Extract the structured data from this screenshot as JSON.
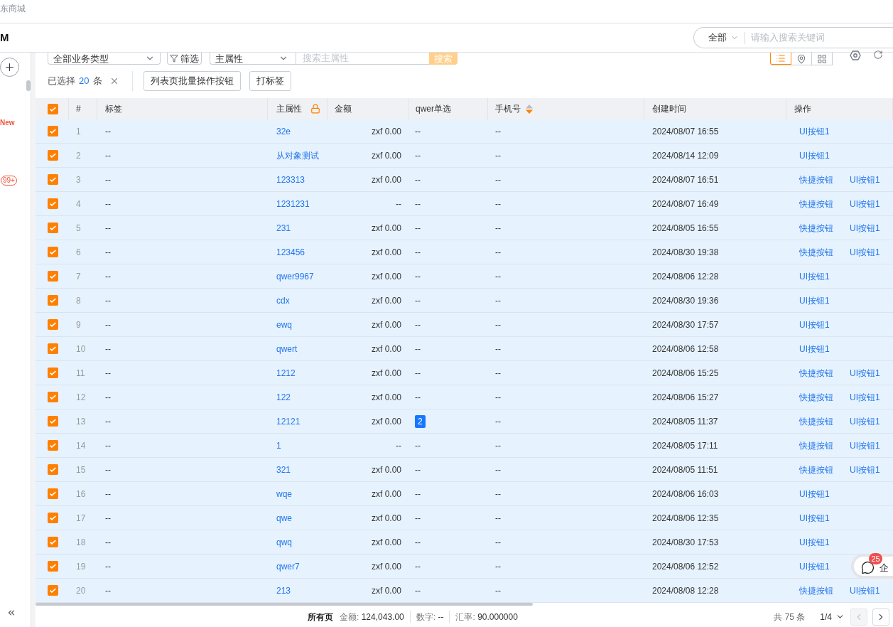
{
  "top_bar": {
    "title": "东商城"
  },
  "header": {
    "logo": "M",
    "search": {
      "scope": "全部",
      "placeholder": "请输入搜索关键词"
    }
  },
  "sidebar": {
    "badges": [
      {
        "kind": "text",
        "text": "New"
      },
      {
        "kind": "pill",
        "text": "99+"
      }
    ]
  },
  "toolbar": {
    "business_type": "全部业务类型",
    "filter": "筛选",
    "field": "主属性",
    "search_placeholder": "搜索主属性",
    "search_button": "搜索",
    "views": [
      {
        "kind": "list",
        "selected": true
      },
      {
        "kind": "map",
        "selected": false
      },
      {
        "kind": "grid",
        "selected": false
      }
    ]
  },
  "selection": {
    "label": "已选择",
    "count": "20",
    "unit": "条",
    "buttons": [
      "列表页批量操作按钮",
      "打标签"
    ]
  },
  "table": {
    "select_all": true,
    "columns": [
      {
        "label": "#",
        "kind": "plain"
      },
      {
        "label": "标签",
        "kind": "plain"
      },
      {
        "label": "主属性",
        "kind": "locked"
      },
      {
        "label": "金额",
        "kind": "plain"
      },
      {
        "label": "qwer单选",
        "kind": "plain"
      },
      {
        "label": "手机号",
        "kind": "sortable",
        "sort_descending": true
      },
      {
        "label": "创建时间",
        "kind": "plain"
      },
      {
        "label": "操作",
        "kind": "plain"
      }
    ],
    "rows": [
      {
        "selected": true,
        "index": "1",
        "tag": "--",
        "name": "32e",
        "amount": "zxf 0.00",
        "radio": {
          "kind": "plain",
          "text": "--"
        },
        "phone": "--",
        "created": "2024/08/07 16:55",
        "actions": [
          "UI按钮1"
        ]
      },
      {
        "selected": true,
        "index": "2",
        "tag": "--",
        "name": "从对象测试",
        "amount": "zxf 0.00",
        "radio": {
          "kind": "plain",
          "text": "--"
        },
        "phone": "--",
        "created": "2024/08/14 12:09",
        "actions": [
          "UI按钮1"
        ]
      },
      {
        "selected": true,
        "index": "3",
        "tag": "--",
        "name": "123313",
        "amount": "zxf 0.00",
        "radio": {
          "kind": "plain",
          "text": "--"
        },
        "phone": "--",
        "created": "2024/08/07 16:51",
        "actions": [
          "快捷按钮",
          "UI按钮1"
        ]
      },
      {
        "selected": true,
        "index": "4",
        "tag": "--",
        "name": "1231231",
        "amount": "--",
        "radio": {
          "kind": "plain",
          "text": "--"
        },
        "phone": "--",
        "created": "2024/08/07 16:49",
        "actions": [
          "快捷按钮",
          "UI按钮1"
        ]
      },
      {
        "selected": true,
        "index": "5",
        "tag": "--",
        "name": "231",
        "amount": "zxf 0.00",
        "radio": {
          "kind": "plain",
          "text": "--"
        },
        "phone": "--",
        "created": "2024/08/05 16:55",
        "actions": [
          "快捷按钮",
          "UI按钮1"
        ]
      },
      {
        "selected": true,
        "index": "6",
        "tag": "--",
        "name": "123456",
        "amount": "zxf 0.00",
        "radio": {
          "kind": "plain",
          "text": "--"
        },
        "phone": "--",
        "created": "2024/08/30 19:38",
        "actions": [
          "快捷按钮",
          "UI按钮1"
        ]
      },
      {
        "selected": true,
        "index": "7",
        "tag": "--",
        "name": "qwer9967",
        "amount": "zxf 0.00",
        "radio": {
          "kind": "plain",
          "text": "--"
        },
        "phone": "--",
        "created": "2024/08/06 12:28",
        "actions": [
          "UI按钮1"
        ]
      },
      {
        "selected": true,
        "index": "8",
        "tag": "--",
        "name": "cdx",
        "amount": "zxf 0.00",
        "radio": {
          "kind": "plain",
          "text": "--"
        },
        "phone": "--",
        "created": "2024/08/30 19:36",
        "actions": [
          "UI按钮1"
        ]
      },
      {
        "selected": true,
        "index": "9",
        "tag": "--",
        "name": "ewq",
        "amount": "zxf 0.00",
        "radio": {
          "kind": "plain",
          "text": "--"
        },
        "phone": "--",
        "created": "2024/08/30 17:57",
        "actions": [
          "UI按钮1"
        ]
      },
      {
        "selected": true,
        "index": "10",
        "tag": "--",
        "name": "qwert",
        "amount": "zxf 0.00",
        "radio": {
          "kind": "plain",
          "text": "--"
        },
        "phone": "--",
        "created": "2024/08/06 12:58",
        "actions": [
          "UI按钮1"
        ]
      },
      {
        "selected": true,
        "index": "11",
        "tag": "--",
        "name": "1212",
        "amount": "zxf 0.00",
        "radio": {
          "kind": "plain",
          "text": "--"
        },
        "phone": "--",
        "created": "2024/08/06 15:25",
        "actions": [
          "快捷按钮",
          "UI按钮1"
        ]
      },
      {
        "selected": true,
        "index": "12",
        "tag": "--",
        "name": "122",
        "amount": "zxf 0.00",
        "radio": {
          "kind": "plain",
          "text": "--"
        },
        "phone": "--",
        "created": "2024/08/06 15:27",
        "actions": [
          "快捷按钮",
          "UI按钮1"
        ]
      },
      {
        "selected": true,
        "index": "13",
        "tag": "--",
        "name": "12121",
        "amount": "zxf 0.00",
        "radio": {
          "kind": "tag",
          "text": "2"
        },
        "phone": "--",
        "created": "2024/08/05 11:37",
        "actions": [
          "快捷按钮",
          "UI按钮1"
        ]
      },
      {
        "selected": true,
        "index": "14",
        "tag": "--",
        "name": "1",
        "amount": "--",
        "radio": {
          "kind": "plain",
          "text": "--"
        },
        "phone": "--",
        "created": "2024/08/05 17:11",
        "actions": [
          "快捷按钮",
          "UI按钮1"
        ]
      },
      {
        "selected": true,
        "index": "15",
        "tag": "--",
        "name": "321",
        "amount": "zxf 0.00",
        "radio": {
          "kind": "plain",
          "text": "--"
        },
        "phone": "--",
        "created": "2024/08/05 11:51",
        "actions": [
          "快捷按钮",
          "UI按钮1"
        ]
      },
      {
        "selected": true,
        "index": "16",
        "tag": "--",
        "name": "wqe",
        "amount": "zxf 0.00",
        "radio": {
          "kind": "plain",
          "text": "--"
        },
        "phone": "--",
        "created": "2024/08/06 16:03",
        "actions": [
          "UI按钮1"
        ]
      },
      {
        "selected": true,
        "index": "17",
        "tag": "--",
        "name": "qwe",
        "amount": "zxf 0.00",
        "radio": {
          "kind": "plain",
          "text": "--"
        },
        "phone": "--",
        "created": "2024/08/06 12:35",
        "actions": [
          "UI按钮1"
        ]
      },
      {
        "selected": true,
        "index": "18",
        "tag": "--",
        "name": "qwq",
        "amount": "zxf 0.00",
        "radio": {
          "kind": "plain",
          "text": "--"
        },
        "phone": "--",
        "created": "2024/08/30 17:53",
        "actions": [
          "UI按钮1"
        ]
      },
      {
        "selected": true,
        "index": "19",
        "tag": "--",
        "name": "qwer7",
        "amount": "zxf 0.00",
        "radio": {
          "kind": "plain",
          "text": "--"
        },
        "phone": "--",
        "created": "2024/08/06 12:52",
        "actions": [
          "UI按钮1"
        ]
      },
      {
        "selected": true,
        "index": "20",
        "tag": "--",
        "name": "213",
        "amount": "zxf 0.00",
        "radio": {
          "kind": "plain",
          "text": "--"
        },
        "phone": "--",
        "created": "2024/08/08 12:28",
        "actions": [
          "快捷按钮",
          "UI按钮1"
        ]
      }
    ]
  },
  "footer": {
    "scope": "所有页",
    "stats": [
      {
        "label": "金额:",
        "value": "124,043.00"
      },
      {
        "label": "数字:",
        "value": "--"
      },
      {
        "label": "汇率:",
        "value": "90.000000"
      }
    ],
    "total": "共 75 条",
    "page": "1/4",
    "pager": [
      {
        "kind": "prev",
        "disabled": true
      },
      {
        "kind": "next",
        "disabled": false
      }
    ]
  },
  "chat": {
    "badge": "25",
    "label": "企"
  }
}
